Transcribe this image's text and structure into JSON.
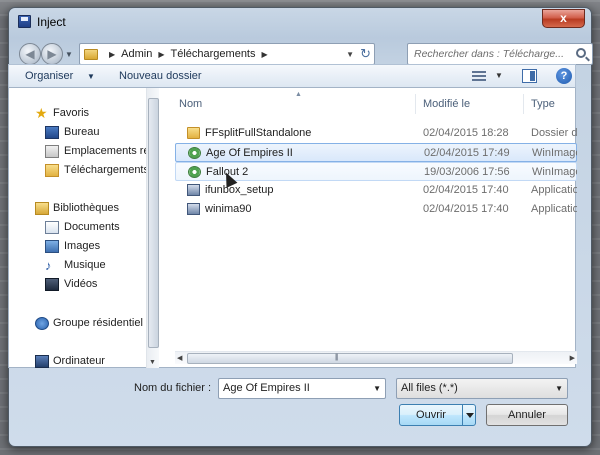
{
  "window": {
    "title": "Inject",
    "close_glyph": "x"
  },
  "nav": {
    "back_glyph": "◀",
    "forward_glyph": "▶",
    "breadcrumbs": [
      "Admin",
      "Téléchargements"
    ],
    "search_placeholder": "Rechercher dans : Télécharge..."
  },
  "toolbar": {
    "organiser_label": "Organiser",
    "new_folder_label": "Nouveau dossier",
    "help_glyph": "?"
  },
  "sidebar": {
    "items": [
      {
        "label": "Favoris",
        "icon": "star-icon"
      },
      {
        "label": "Bureau",
        "icon": "desktop-icon"
      },
      {
        "label": "Emplacements ré",
        "icon": "places-icon"
      },
      {
        "label": "Téléchargements",
        "icon": "downloads-icon"
      },
      {
        "label": "Bibliothèques",
        "icon": "libraries-icon"
      },
      {
        "label": "Documents",
        "icon": "documents-icon"
      },
      {
        "label": "Images",
        "icon": "images-icon"
      },
      {
        "label": "Musique",
        "icon": "music-icon"
      },
      {
        "label": "Vidéos",
        "icon": "videos-icon"
      },
      {
        "label": "Groupe résidentiel",
        "icon": "homegroup-icon"
      },
      {
        "label": "Ordinateur",
        "icon": "computer-icon"
      }
    ]
  },
  "files": {
    "columns": [
      "Nom",
      "Modifié le",
      "Type"
    ],
    "rows": [
      {
        "name": "FFsplitFullStandalone",
        "date": "02/04/2015 18:28",
        "type": "Dossier de fic",
        "icon": "folder-icon"
      },
      {
        "name": "Age Of Empires II",
        "date": "02/04/2015 17:49",
        "type": "WinImage IS",
        "icon": "disc-image-icon"
      },
      {
        "name": "Fallout 2",
        "date": "19/03/2006 17:56",
        "type": "WinImage IS",
        "icon": "disc-image-icon"
      },
      {
        "name": "ifunbox_setup",
        "date": "02/04/2015 17:40",
        "type": "Application",
        "icon": "application-icon"
      },
      {
        "name": "winima90",
        "date": "02/04/2015 17:40",
        "type": "Application",
        "icon": "application-icon"
      }
    ]
  },
  "bottom": {
    "filename_label": "Nom du fichier :",
    "filename_value": "Age Of Empires II",
    "filter_value": "All files (*.*)",
    "open_label": "Ouvrir",
    "cancel_label": "Annuler"
  }
}
